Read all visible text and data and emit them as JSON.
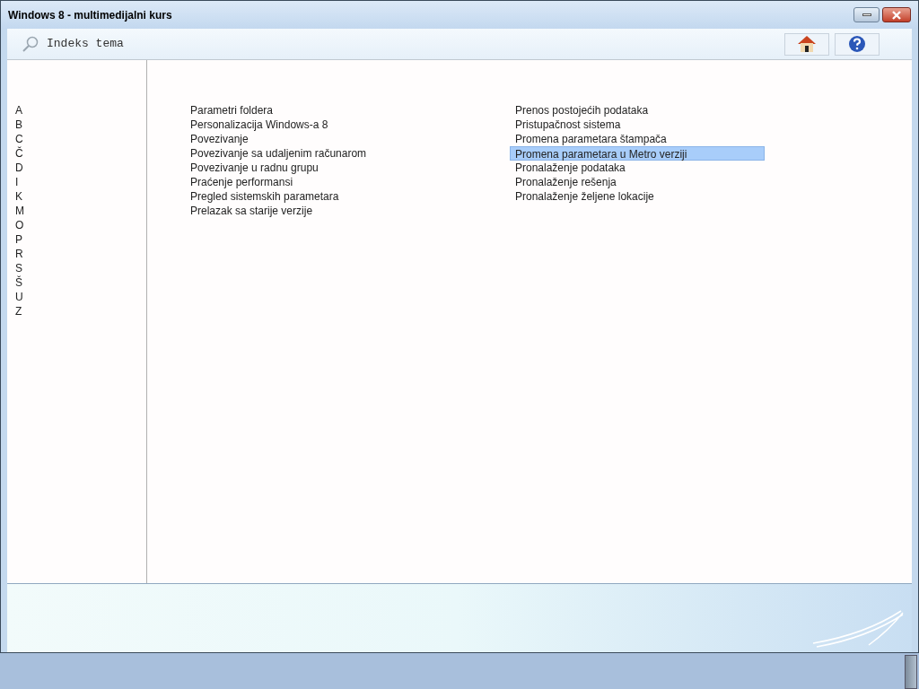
{
  "window": {
    "title": "Windows 8 - multimedijalni kurs"
  },
  "toolbar": {
    "title": "Indeks tema"
  },
  "letters": [
    "A",
    "B",
    "C",
    "Č",
    "D",
    "I",
    "K",
    "M",
    "O",
    "P",
    "R",
    "S",
    "Š",
    "U",
    "Z"
  ],
  "topic_columns": [
    [
      {
        "label": "Parametri foldera",
        "selected": false
      },
      {
        "label": "Personalizacija Windows-a 8",
        "selected": false
      },
      {
        "label": "Povezivanje",
        "selected": false
      },
      {
        "label": "Povezivanje sa udaljenim računarom",
        "selected": false
      },
      {
        "label": "Povezivanje u radnu grupu",
        "selected": false
      },
      {
        "label": "Praćenje performansi",
        "selected": false
      },
      {
        "label": "Pregled sistemskih parametara",
        "selected": false
      },
      {
        "label": "Prelazak sa starije verzije",
        "selected": false
      }
    ],
    [
      {
        "label": "Prenos postojećih podataka",
        "selected": false
      },
      {
        "label": "Pristupačnost sistema",
        "selected": false
      },
      {
        "label": "Promena parametara štampača",
        "selected": false
      },
      {
        "label": "Promena parametara u Metro verziji",
        "selected": true
      },
      {
        "label": "Pronalaženje podataka",
        "selected": false
      },
      {
        "label": "Pronalaženje rešenja",
        "selected": false
      },
      {
        "label": "Pronalaženje željene lokacije",
        "selected": false
      }
    ]
  ]
}
